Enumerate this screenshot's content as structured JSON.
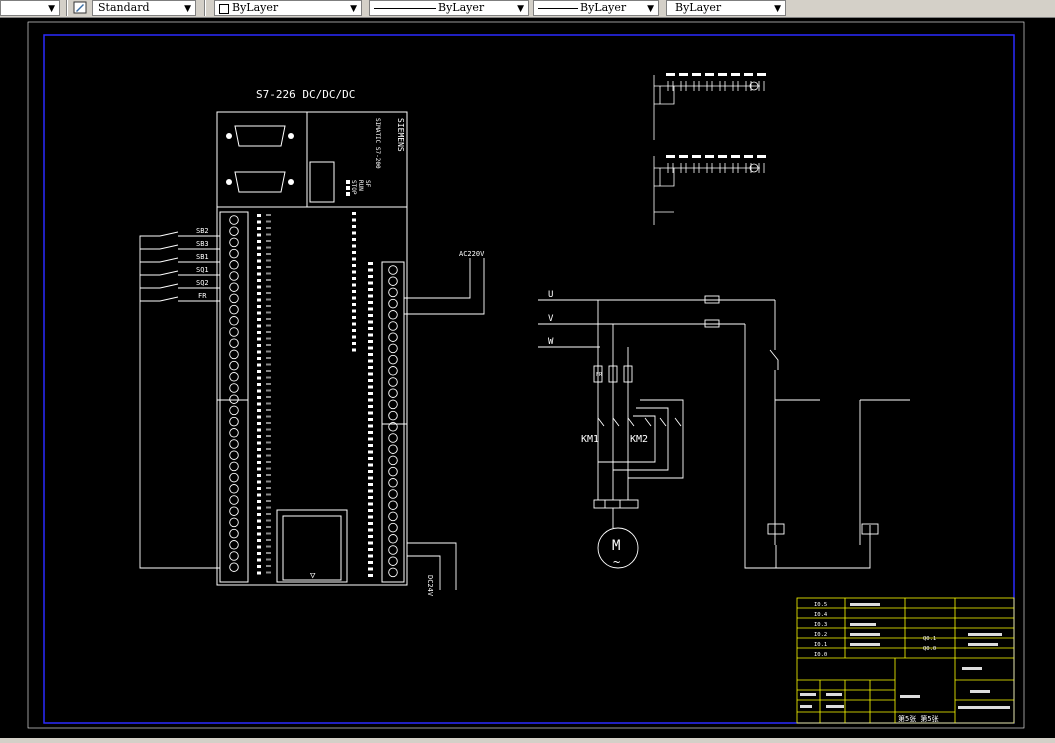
{
  "toolbar": {
    "text_style": "Standard",
    "layer_color": "ByLayer",
    "linetype": "ByLayer",
    "lineweight": "ByLayer",
    "plot_style": "ByLayer"
  },
  "drawing": {
    "plc_title": "S7-226 DC/DC/DC",
    "siemens": "SIEMENS",
    "plc_model": "SIMATIC S7-200",
    "run_labels": [
      "SF",
      "RUN",
      "STOP"
    ],
    "inputs": [
      "SB2",
      "SB3",
      "SB1",
      "SQ1",
      "SQ2",
      "FR"
    ],
    "ac_supply": "AC220V",
    "dc_supply": "DC24V",
    "phases": [
      "U",
      "V",
      "W"
    ],
    "contactors": [
      "KM1",
      "KM2"
    ],
    "motor": "M",
    "motor_symbol": "~",
    "relay_fr": "FR"
  },
  "title_block": {
    "io_inputs": [
      "I0.5",
      "I0.4",
      "I0.3",
      "I0.2",
      "I0.1",
      "I0.0"
    ],
    "io_outputs": [
      "Q0.1",
      "Q0.0"
    ],
    "sheet_text": "第5张 第5张"
  },
  "colors": {
    "canvas": "#000000",
    "border": "#0000ff",
    "lines": "#ffffff",
    "titleblock": "#ffff00"
  }
}
